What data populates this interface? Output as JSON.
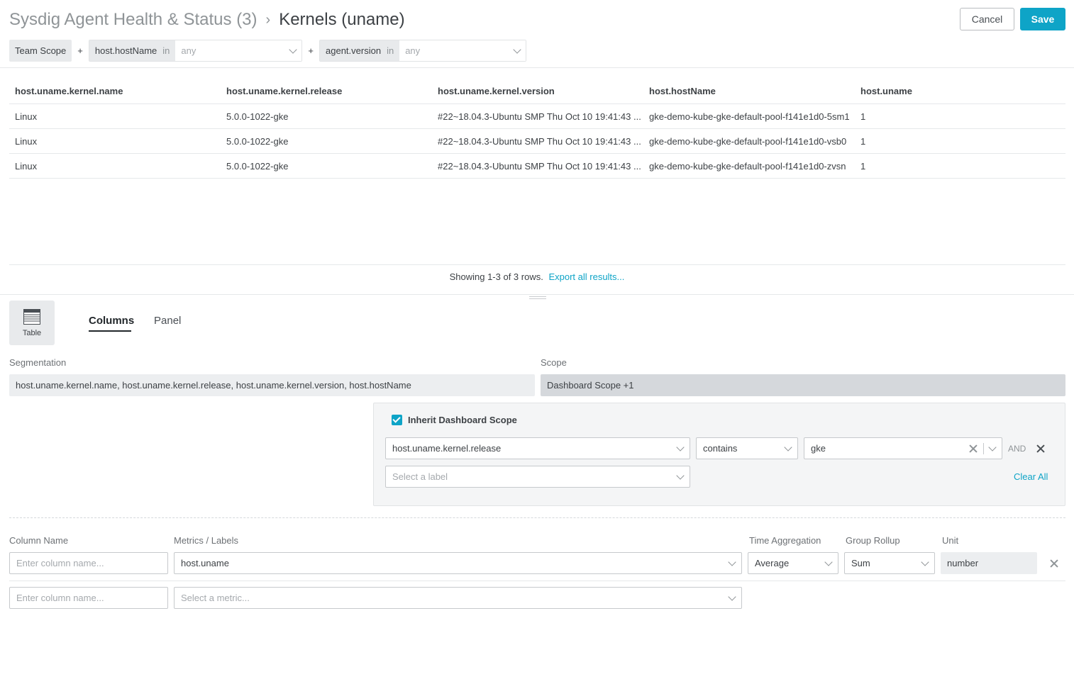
{
  "header": {
    "parent": "Sysdig Agent Health & Status (3)",
    "current": "Kernels (uname)",
    "cancel_label": "Cancel",
    "save_label": "Save"
  },
  "scope_bar": {
    "team_scope": "Team Scope",
    "plus": "+",
    "filters": [
      {
        "label": "host.hostName",
        "op": "in",
        "value": "any"
      },
      {
        "label": "agent.version",
        "op": "in",
        "value": "any"
      }
    ]
  },
  "table": {
    "headers": [
      "host.uname.kernel.name",
      "host.uname.kernel.release",
      "host.uname.kernel.version",
      "host.hostName",
      "host.uname"
    ],
    "rows": [
      [
        "Linux",
        "5.0.0-1022-gke",
        "#22~18.04.3-Ubuntu SMP Thu Oct 10 19:41:43 ...",
        "gke-demo-kube-gke-default-pool-f141e1d0-5sm1",
        "1"
      ],
      [
        "Linux",
        "5.0.0-1022-gke",
        "#22~18.04.3-Ubuntu SMP Thu Oct 10 19:41:43 ...",
        "gke-demo-kube-gke-default-pool-f141e1d0-vsb0",
        "1"
      ],
      [
        "Linux",
        "5.0.0-1022-gke",
        "#22~18.04.3-Ubuntu SMP Thu Oct 10 19:41:43 ...",
        "gke-demo-kube-gke-default-pool-f141e1d0-zvsn",
        "1"
      ]
    ],
    "footer_text": "Showing 1-3 of 3 rows.",
    "export_link": "Export all results..."
  },
  "editor": {
    "viz_type": "Table",
    "tabs": [
      {
        "label": "Columns",
        "active": true
      },
      {
        "label": "Panel",
        "active": false
      }
    ],
    "segmentation_label": "Segmentation",
    "segmentation_value": "host.uname.kernel.name, host.uname.kernel.release, host.uname.kernel.version, host.hostName",
    "scope_label": "Scope",
    "scope_value": "Dashboard Scope +1",
    "inherit_label": "Inherit Dashboard Scope",
    "inherit_checked": true,
    "scope_filter": {
      "label": "host.uname.kernel.release",
      "operator": "contains",
      "value": "gke",
      "and": "AND"
    },
    "select_label_placeholder": "Select a label",
    "clear_all": "Clear All"
  },
  "columns": {
    "headers": {
      "name": "Column Name",
      "metrics": "Metrics / Labels",
      "time_agg": "Time Aggregation",
      "group_rollup": "Group Rollup",
      "unit": "Unit"
    },
    "name_placeholder": "Enter column name...",
    "metric_placeholder": "Select a metric...",
    "rows": [
      {
        "metric": "host.uname",
        "time_agg": "Average",
        "group_rollup": "Sum",
        "unit": "number"
      }
    ]
  },
  "colors": {
    "accent": "#0ea4c7",
    "text": "#3d4145",
    "muted": "#8f9497"
  }
}
